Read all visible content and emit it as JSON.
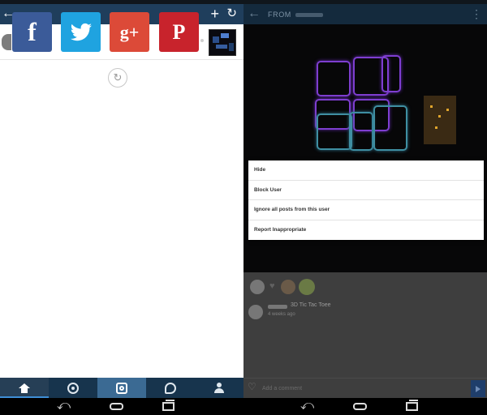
{
  "left": {
    "header": {
      "title": "",
      "add_icon": "plus-icon",
      "refresh_icon": "refresh-icon"
    },
    "share": [
      {
        "id": "facebook",
        "glyph": "f",
        "color": "#3b5b99"
      },
      {
        "id": "twitter",
        "glyph": "twitter-bird",
        "color": "#1fa3e0"
      },
      {
        "id": "googleplus",
        "glyph": "g+",
        "color": "#dc4a38"
      },
      {
        "id": "pinterest",
        "glyph": "P",
        "color": "#c8232c"
      }
    ],
    "nav": [
      "home",
      "explore",
      "camera",
      "activity",
      "profile"
    ]
  },
  "right": {
    "header": {
      "title": "FROM"
    },
    "menu": [
      "Hide",
      "Block User",
      "Ignore all posts from this user",
      "Report Inappropriate"
    ],
    "comment": {
      "text": "3D Tic Tac Toee",
      "time": "4 weeks ago"
    },
    "input_placeholder": "Add a comment"
  }
}
